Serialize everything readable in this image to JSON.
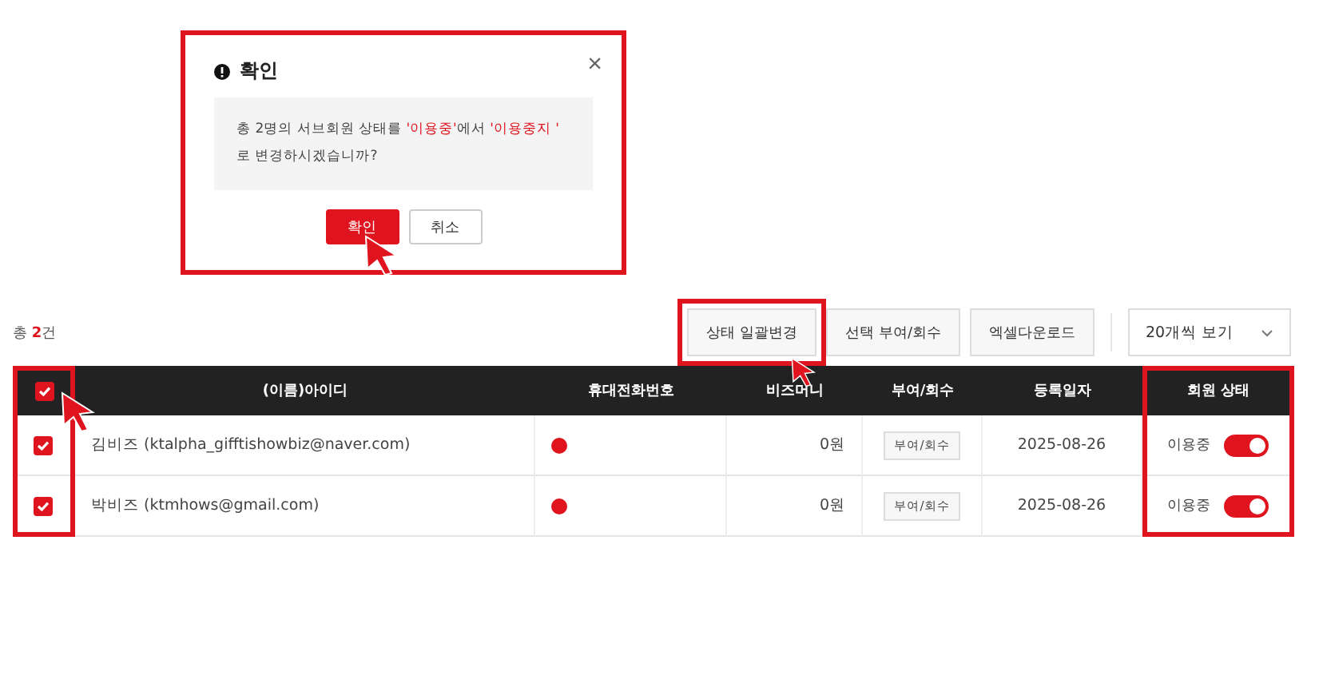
{
  "dialog": {
    "title": "확인",
    "close": "×",
    "highlighted": true,
    "message_parts": [
      {
        "text": "총 2명의 서브회원 상태를 ",
        "emphasis": false
      },
      {
        "text": "'이용중'",
        "emphasis": true
      },
      {
        "text": "에서 ",
        "emphasis": false
      },
      {
        "text": "'이용중지 '",
        "emphasis": true
      },
      {
        "text": " 로 변경하시겠습니까?",
        "emphasis": false
      }
    ],
    "buttons": [
      {
        "label": "확인",
        "kind": "primary",
        "pointer": true
      },
      {
        "label": "취소",
        "kind": "secondary",
        "pointer": false
      }
    ]
  },
  "total": {
    "prefix": "총 ",
    "count": "2",
    "suffix": "건"
  },
  "toolbar": {
    "buttons": [
      {
        "label": "상태 일괄변경",
        "highlighted": true,
        "pointer": true
      },
      {
        "label": "선택 부여/회수",
        "highlighted": false,
        "pointer": false
      },
      {
        "label": "엑셀다운로드",
        "highlighted": false,
        "pointer": false
      }
    ],
    "page_size": "20개씩 보기"
  },
  "table": {
    "select_all": {
      "checked": true,
      "highlighted": true,
      "pointer": true
    },
    "columns": [
      {
        "label": "(이름)아이디",
        "highlighted": false
      },
      {
        "label": "휴대전화번호",
        "highlighted": false
      },
      {
        "label": "비즈머니",
        "highlighted": false
      },
      {
        "label": "부여/회수",
        "highlighted": false
      },
      {
        "label": "등록일자",
        "highlighted": false
      },
      {
        "label": "회원 상태",
        "highlighted": true
      }
    ],
    "rows": [
      {
        "checked": true,
        "member": "김비즈 (ktalpha_gifftishowbiz@naver.com)",
        "phone_alert": true,
        "bizmoney": "0원",
        "grant": "부여/회수",
        "date": "2025-08-26",
        "status": "이용중",
        "on": true
      },
      {
        "checked": true,
        "member": "박비즈 (ktmhows@gmail.com)",
        "phone_alert": true,
        "bizmoney": "0원",
        "grant": "부여/회수",
        "date": "2025-08-26",
        "status": "이용중",
        "on": true
      }
    ]
  }
}
